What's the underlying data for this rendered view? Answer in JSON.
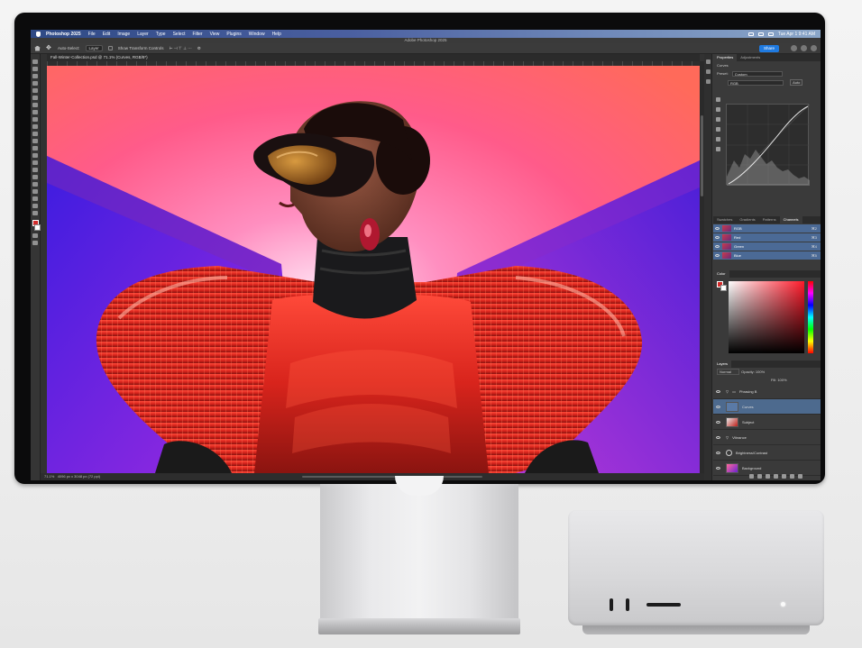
{
  "menubar": {
    "app": "Photoshop 2025",
    "items": [
      "File",
      "Edit",
      "Image",
      "Layer",
      "Type",
      "Select",
      "Filter",
      "View",
      "Plugins",
      "Window",
      "Help"
    ],
    "clock": "Tue Apr 1  9:41 AM"
  },
  "window_title": "Adobe Photoshop 2025",
  "options_bar": {
    "auto_select_label": "Auto-Select:",
    "auto_select_value": "Layer",
    "show_transform_label": "Show Transform Controls",
    "share_label": "Share"
  },
  "document_tab": "Fall-Winter-Collection.psd @ 71.1% (Curves, RGB/8*)",
  "status_bar": {
    "zoom": "71.1%",
    "size": "4096 px x 3048 px (72 ppi)"
  },
  "properties_panel": {
    "tabs": [
      "Properties",
      "Adjustments"
    ],
    "section": "Curves",
    "preset_label": "Preset:",
    "preset_value": "Custom",
    "channel_value": "RGB",
    "auto_label": "Auto"
  },
  "channels_panel": {
    "tabs": [
      "Swatches",
      "Gradients",
      "Patterns",
      "Channels"
    ],
    "rows": [
      {
        "name": "RGB",
        "key": "⌘2"
      },
      {
        "name": "Red",
        "key": "⌘3"
      },
      {
        "name": "Green",
        "key": "⌘4"
      },
      {
        "name": "Blue",
        "key": "⌘5"
      }
    ]
  },
  "color_panel": {
    "title": "Color",
    "foreground": "#d42a2a",
    "background": "#ffffff"
  },
  "layers_panel": {
    "title": "Layers",
    "blend_mode": "Normal",
    "opacity_label": "Opacity: 100%",
    "fill_label": "Fill: 100%",
    "layers": [
      {
        "name": "Phrasing B",
        "type": "group"
      },
      {
        "name": "Curves",
        "type": "adjustment",
        "selected": true
      },
      {
        "name": "Subject",
        "type": "pixel"
      },
      {
        "name": "Vibrance",
        "type": "adjustment"
      },
      {
        "name": "Brightness/Contrast",
        "type": "adjustment"
      },
      {
        "name": "Background",
        "type": "pixel"
      }
    ]
  },
  "colors": {
    "accent_blue": "#1f7ae0",
    "selected_layer": "#4d6a8e",
    "photo_backdrop_pink": "#ff5b8a",
    "photo_backdrop_purple": "#5a22d8",
    "outfit_red": "#d6281f"
  }
}
